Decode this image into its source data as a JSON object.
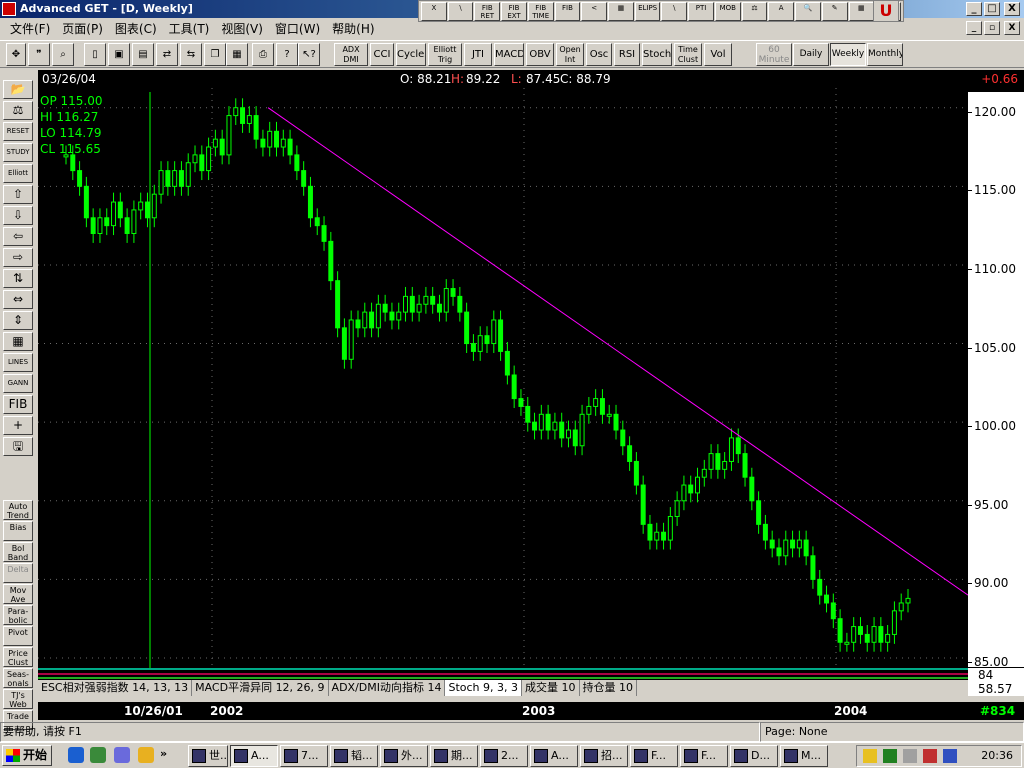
{
  "window": {
    "title": "Advanced GET - [D, Weekly]",
    "controls": [
      "_",
      "□",
      "X"
    ]
  },
  "menu": [
    "文件(F)",
    "页面(P)",
    "图表(C)",
    "工具(T)",
    "视图(V)",
    "窗口(W)",
    "帮助(H)"
  ],
  "float_toolbar": [
    "X",
    "\\",
    "FIB RET",
    "FIB EXT",
    "FIB TIME",
    "FIB",
    "<",
    "▦",
    "ELIPS",
    "\\",
    "PTI",
    "MOB",
    "⚖",
    "A",
    "🔍",
    "✎",
    "▦",
    "▤"
  ],
  "toolbar2": {
    "indicators": [
      "ADX DMI",
      "CCI",
      "Cycles",
      "Elliott Trig",
      "JTI",
      "MACD",
      "OBV",
      "Open Int",
      "Osc",
      "RSI",
      "Stoch",
      "Time Clust",
      "Vol"
    ],
    "intervals": [
      "60 Minute",
      "Daily",
      "Weekly",
      "Monthly"
    ],
    "active_interval": "Weekly"
  },
  "left_panel": {
    "top": [
      "📂",
      "⚖",
      "RESET",
      "STUDY",
      "Elliott",
      "⇧",
      "⇩",
      "⇦",
      "⇨",
      "⇅",
      "⇔",
      "⇕",
      "▦",
      "LINES",
      "GANN",
      "FIB",
      "+",
      "🖫"
    ],
    "bottom": [
      "Auto Trend",
      "Bias",
      "Bol Band",
      "Delta",
      "Mov Ave",
      "Para- bolic",
      "Pivot",
      "Price Clust",
      "Seas- onals",
      "TJ's Web",
      "Trade"
    ]
  },
  "header": {
    "date": "03/26/04",
    "open": "O: 88.21",
    "high": "H: 89.22",
    "low": "L: 87.45",
    "close": "C: 88.79",
    "change": "+0.66"
  },
  "ohlc_panel": [
    "OP 115.00",
    "HI  116.27",
    "LO  114.79",
    "CL  115.65"
  ],
  "indicator_tabs": [
    "ESC相对强弱指数 14, 13, 13",
    "MACD平滑异同 12, 26, 9",
    "ADX/DMI动向指标 14",
    "Stoch 9, 3, 3",
    "成交量 10",
    "持仓量 10"
  ],
  "active_tab": "Stoch 9, 3, 3",
  "indicator_values": {
    "top": "84",
    "bottom": "58.57"
  },
  "date_axis": {
    "labels": [
      "10/26/01",
      "2002",
      "2003",
      "2004"
    ],
    "bar_count": "#834"
  },
  "status": {
    "help": "要帮助, 请按 F1",
    "page": "Page: None"
  },
  "taskbar": {
    "start": "开始",
    "tasks": [
      "世...",
      "A...",
      "7...",
      "韬...",
      "外...",
      "期...",
      "2...",
      "A...",
      "招...",
      "F...",
      "F...",
      "D...",
      "M..."
    ],
    "clock": "20:36"
  },
  "colors": {
    "candle": "#00ff00",
    "trendline": "#ff00ff",
    "grid": "#6a6a6a",
    "change": "#ff3030"
  },
  "chart_data": {
    "type": "candlestick",
    "ylim": [
      85,
      121
    ],
    "y_ticks": [
      "120.00",
      "115.00",
      "110.00",
      "105.00",
      "100.00",
      "95.00",
      "90.00",
      "85.00"
    ],
    "x_labels": [
      "10/26/01",
      "2002",
      "2003",
      "2004"
    ],
    "closes": [
      117,
      116,
      115,
      113,
      112,
      113,
      112.5,
      114,
      113,
      112,
      113.5,
      114,
      113,
      114.5,
      116,
      115,
      116,
      115,
      116.5,
      117,
      116,
      117.5,
      118,
      117,
      119.5,
      120,
      119,
      119.5,
      118,
      117.5,
      118.5,
      117.5,
      118,
      117,
      116,
      115,
      113,
      112.5,
      111.5,
      109,
      106,
      104,
      106.5,
      106,
      107,
      106,
      107.5,
      107,
      106.5,
      107,
      108,
      107,
      107.5,
      108,
      107.5,
      107,
      108.5,
      108,
      107,
      105,
      104.5,
      105.5,
      105,
      106.5,
      104.5,
      103,
      101.5,
      101,
      100,
      99.5,
      100.5,
      99.5,
      100,
      99,
      99.5,
      98.5,
      100.5,
      101,
      101.5,
      100.5,
      100.5,
      99.5,
      98.5,
      97.5,
      96,
      93.5,
      92.5,
      93,
      92.5,
      94,
      95,
      96,
      95.5,
      96.5,
      97,
      98,
      97,
      97.5,
      99,
      98,
      96.5,
      95,
      93.5,
      92.5,
      92,
      91.5,
      92.5,
      92,
      92.5,
      91.5,
      90,
      89,
      88.5,
      87.5,
      86,
      86,
      87,
      86.5,
      86,
      87,
      86,
      86.5,
      88,
      88.5,
      88.79
    ],
    "trendline": {
      "from": [
        0.24,
        120
      ],
      "to": [
        1.0,
        89
      ]
    },
    "vline_label": "10/26/01"
  }
}
